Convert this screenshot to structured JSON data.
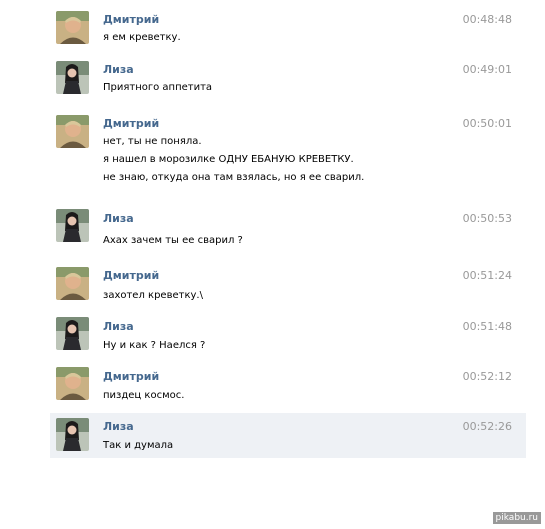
{
  "messages": [
    {
      "author": "Дмитрий",
      "avatar_icon": "dmitry-avatar-icon",
      "time": "00:48:48",
      "lines": [
        "я ем креветку."
      ]
    },
    {
      "author": "Лиза",
      "avatar_icon": "liza-avatar-icon",
      "time": "00:49:01",
      "lines": [
        "Приятного аппетита"
      ]
    },
    {
      "author": "Дмитрий",
      "avatar_icon": "dmitry-avatar-icon",
      "time": "00:50:01",
      "lines": [
        "нет, ты не поняла.",
        "я нашел в морозилке ОДНУ ЕБАНУЮ КРЕВЕТКУ.",
        "не знаю, откуда она там взялась, но я ее сварил."
      ]
    },
    {
      "author": "Лиза",
      "avatar_icon": "liza-avatar-icon",
      "time": "00:50:53",
      "lines": [
        "Ахах зачем ты ее сварил ?"
      ]
    },
    {
      "author": "Дмитрий",
      "avatar_icon": "dmitry-avatar-icon",
      "time": "00:51:24",
      "lines": [
        "захотел креветку.\\"
      ]
    },
    {
      "author": "Лиза",
      "avatar_icon": "liza-avatar-icon",
      "time": "00:51:48",
      "lines": [
        "Ну и как ? Наелся ?"
      ]
    },
    {
      "author": "Дмитрий",
      "avatar_icon": "dmitry-avatar-icon",
      "time": "00:52:12",
      "lines": [
        "пиздец космос."
      ]
    },
    {
      "author": "Лиза",
      "avatar_icon": "liza-avatar-icon",
      "time": "00:52:26",
      "lines": [
        "Так и думала"
      ]
    }
  ],
  "highlight_color": "#eef1f5",
  "name_color": "#45688e",
  "watermark": "pikabu.ru"
}
